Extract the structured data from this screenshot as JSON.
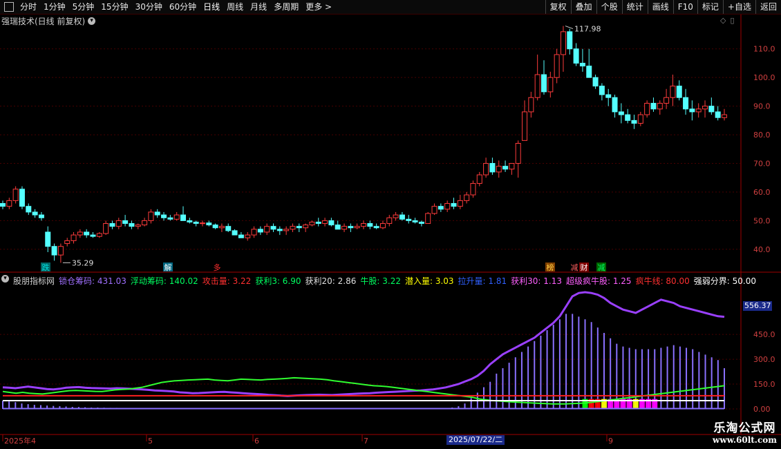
{
  "toolbar": {
    "left": [
      "分时",
      "1分钟",
      "5分钟",
      "15分钟",
      "30分钟",
      "60分钟",
      "日线",
      "周线",
      "月线",
      "多周期",
      "更多 >"
    ],
    "active": "日线",
    "right": [
      "复权",
      "叠加",
      "个股",
      "统计",
      "画线",
      "F10",
      "标记",
      "+自选",
      "返回"
    ]
  },
  "main_panel": {
    "title": "强瑞技术(日线 前复权)",
    "high_label": "117.98",
    "low_label": "35.29",
    "price_ticks": [
      "110.0",
      "100.0",
      "90.0",
      "80.0",
      "70.0",
      "60.0",
      "50.0",
      "40.0"
    ],
    "markers": [
      {
        "text": "跌",
        "color": "#00e0e0",
        "bg": "#006666"
      },
      {
        "text": "解",
        "color": "#ffffff",
        "bg": "#006680"
      },
      {
        "text": "多",
        "color": "#ff3030",
        "bg": ""
      },
      {
        "text": "榜",
        "color": "#ffcc44",
        "bg": "#804000"
      },
      {
        "text": "减",
        "color": "#ff6060",
        "bg": ""
      },
      {
        "text": "财",
        "color": "#ffffff",
        "bg": "#800000"
      },
      {
        "text": "减",
        "color": "#00ff66",
        "bg": "#006600"
      }
    ]
  },
  "indicator_panel": {
    "title": "股朋指标网",
    "items": [
      {
        "label": "锁仓筹码: 431.03",
        "color": "#a070ff"
      },
      {
        "label": "浮动筹码: 140.02",
        "color": "#00ff60"
      },
      {
        "label": "攻击量: 3.22",
        "color": "#ff3030"
      },
      {
        "label": "获利3: 6.90",
        "color": "#00ff60"
      },
      {
        "label": "获利20: 2.86",
        "color": "#e0e0e0"
      },
      {
        "label": "牛股: 3.22",
        "color": "#00ff60"
      },
      {
        "label": "潜入量: 3.03",
        "color": "#ffff00"
      },
      {
        "label": "拉升量: 1.81",
        "color": "#3060ff"
      },
      {
        "label": "获利30: 1.13",
        "color": "#ff60ff"
      },
      {
        "label": "超级疯牛股: 1.25",
        "color": "#ff60ff"
      },
      {
        "label": "疯牛线: 80.00",
        "color": "#ff3030"
      },
      {
        "label": "强弱分界: 50.00",
        "color": "#ffffff"
      }
    ],
    "ticks": [
      "450.0",
      "300.0",
      "150.0",
      "0.00"
    ],
    "current_value": "556.37"
  },
  "x_axis": {
    "labels": [
      "2025年4",
      "5",
      "6",
      "7",
      "8",
      "9"
    ],
    "cursor_date": "2025/07/22/二"
  },
  "watermark": {
    "line1": "乐淘公式网",
    "line2": "www.60lt.com"
  },
  "colors": {
    "up": "#ff3c3c",
    "down": "#54ffff",
    "grid": "#4a0000",
    "axis": "#a00000"
  },
  "chart_data": {
    "type": "candlestick",
    "ylim": [
      32,
      122
    ],
    "candles": [
      [
        56,
        57,
        54,
        55
      ],
      [
        55,
        58,
        54,
        57
      ],
      [
        57,
        62,
        56,
        61
      ],
      [
        61,
        62,
        54,
        55
      ],
      [
        55,
        56,
        52,
        53
      ],
      [
        53,
        54,
        51,
        52
      ],
      [
        52,
        53,
        50,
        51
      ],
      [
        46,
        48,
        39,
        41
      ],
      [
        41,
        42,
        36,
        38
      ],
      [
        38,
        42,
        35.29,
        41
      ],
      [
        42,
        44,
        41,
        43
      ],
      [
        43,
        46,
        42,
        45
      ],
      [
        45,
        47,
        44,
        46
      ],
      [
        46,
        47,
        44,
        45
      ],
      [
        45,
        46,
        44,
        44.5
      ],
      [
        44.5,
        46,
        44,
        45.5
      ],
      [
        45.5,
        50,
        45,
        49
      ],
      [
        49,
        50,
        47,
        48
      ],
      [
        48,
        51,
        47,
        50
      ],
      [
        50,
        52,
        48,
        49
      ],
      [
        49,
        50,
        47,
        48
      ],
      [
        48,
        49,
        47,
        48.5
      ],
      [
        48.5,
        51,
        48,
        50
      ],
      [
        50,
        54,
        49,
        53
      ],
      [
        53,
        54,
        51,
        52
      ],
      [
        52,
        53,
        50,
        51
      ],
      [
        51,
        52,
        50,
        50.5
      ],
      [
        50.5,
        53,
        50,
        52
      ],
      [
        52,
        55,
        51,
        50
      ],
      [
        50,
        51,
        49,
        49.5
      ],
      [
        49.5,
        50,
        48,
        49
      ],
      [
        49,
        50,
        48,
        49.2
      ],
      [
        49.2,
        50,
        48,
        48.5
      ],
      [
        48.5,
        49,
        47,
        47.5
      ],
      [
        47.5,
        49,
        46,
        48
      ],
      [
        48,
        49,
        46,
        46.5
      ],
      [
        46.5,
        47,
        45,
        45
      ],
      [
        45,
        46,
        44,
        44
      ],
      [
        44,
        46,
        43,
        45
      ],
      [
        45,
        48,
        44,
        47
      ],
      [
        47,
        48,
        45,
        46
      ],
      [
        46,
        49,
        45,
        48
      ],
      [
        48,
        49,
        46,
        47
      ],
      [
        47,
        48,
        45,
        46.5
      ],
      [
        46.5,
        48,
        45,
        47
      ],
      [
        47,
        49,
        46,
        48
      ],
      [
        48,
        49,
        46,
        47.5
      ],
      [
        47.5,
        49,
        46,
        48.5
      ],
      [
        48.5,
        50,
        48,
        49.5
      ],
      [
        49.5,
        51,
        48,
        49
      ],
      [
        49,
        51,
        48,
        50
      ],
      [
        50,
        51,
        48,
        48.5
      ],
      [
        48.5,
        50,
        47,
        47
      ],
      [
        47,
        49,
        46,
        48
      ],
      [
        48,
        49,
        46,
        47.5
      ],
      [
        47.5,
        49,
        47,
        48
      ],
      [
        48,
        50,
        47,
        49
      ],
      [
        49,
        50,
        47,
        48
      ],
      [
        48,
        49,
        47,
        47.5
      ],
      [
        47.5,
        50,
        47,
        49
      ],
      [
        49,
        52,
        48,
        51
      ],
      [
        51,
        53,
        50,
        52
      ],
      [
        52,
        53,
        50,
        50.5
      ],
      [
        50.5,
        52,
        49,
        50
      ],
      [
        50,
        51,
        49,
        49.5
      ],
      [
        49.5,
        50,
        48,
        49
      ],
      [
        49,
        53,
        49,
        52.5
      ],
      [
        52.5,
        56,
        52,
        55
      ],
      [
        55,
        56,
        53,
        54
      ],
      [
        54,
        57,
        53,
        56
      ],
      [
        56,
        58,
        54,
        55
      ],
      [
        55,
        59,
        54,
        57
      ],
      [
        57,
        60,
        56,
        59
      ],
      [
        59,
        64,
        58,
        63
      ],
      [
        63,
        67,
        62,
        66
      ],
      [
        66,
        72,
        65,
        70
      ],
      [
        70,
        72,
        66,
        67
      ],
      [
        67,
        71,
        65,
        69
      ],
      [
        69,
        71,
        67,
        68
      ],
      [
        68,
        70,
        66,
        70
      ],
      [
        70,
        78,
        65,
        77
      ],
      [
        78,
        92,
        79,
        88
      ],
      [
        88,
        95,
        86,
        93
      ],
      [
        93,
        108,
        92,
        101
      ],
      [
        101,
        106,
        94,
        95
      ],
      [
        95,
        102,
        93,
        100
      ],
      [
        100,
        110,
        98,
        108
      ],
      [
        108,
        118,
        102,
        116
      ],
      [
        116,
        117,
        108,
        110
      ],
      [
        110,
        112,
        104,
        105
      ],
      [
        105,
        110,
        102,
        104
      ],
      [
        104,
        110,
        100,
        100
      ],
      [
        100,
        101,
        96,
        97
      ],
      [
        97,
        98,
        92,
        94
      ],
      [
        94,
        96,
        90,
        93
      ],
      [
        93,
        94,
        86,
        88
      ],
      [
        88,
        91,
        84,
        87
      ],
      [
        87,
        89,
        84,
        85
      ],
      [
        85,
        87,
        82,
        84
      ],
      [
        84,
        88,
        83,
        87
      ],
      [
        87,
        92,
        86,
        91
      ],
      [
        91,
        93,
        88,
        89
      ],
      [
        89,
        92,
        87,
        91
      ],
      [
        91,
        96,
        89,
        93
      ],
      [
        93,
        101,
        90,
        97
      ],
      [
        97,
        99,
        92,
        93
      ],
      [
        93,
        96,
        87,
        89
      ],
      [
        89,
        92,
        85,
        88
      ],
      [
        88,
        91,
        86,
        89
      ],
      [
        89,
        92,
        86,
        90
      ],
      [
        90,
        93,
        87,
        88
      ],
      [
        88,
        90,
        85,
        86
      ],
      [
        86,
        89,
        85,
        87
      ]
    ],
    "indicator": {
      "ylim": [
        0,
        680
      ],
      "lock_chip_line": [
        130,
        128,
        125,
        130,
        135,
        130,
        125,
        120,
        118,
        122,
        128,
        130,
        132,
        128,
        126,
        125,
        124,
        123,
        125,
        124,
        122,
        120,
        118,
        115,
        112,
        110,
        108,
        105,
        100,
        98,
        95,
        96,
        98,
        100,
        102,
        103,
        100,
        98,
        95,
        92,
        90,
        88,
        85,
        83,
        80,
        78,
        80,
        82,
        84,
        85,
        86,
        85,
        84,
        86,
        88,
        90,
        92,
        94,
        95,
        98,
        100,
        102,
        104,
        106,
        108,
        110,
        112,
        115,
        118,
        124,
        130,
        140,
        150,
        165,
        180,
        200,
        230,
        270,
        300,
        330,
        350,
        370,
        390,
        410,
        430,
        460,
        490,
        520,
        560,
        620,
        680,
        700,
        705,
        700,
        690,
        670,
        640,
        620,
        600,
        590,
        580,
        600,
        620,
        640,
        660,
        650,
        640,
        620,
        610,
        600,
        590,
        580,
        570,
        560,
        556.37
      ],
      "float_chip_line": [
        105,
        100,
        95,
        100,
        95,
        92,
        90,
        95,
        100,
        105,
        110,
        112,
        110,
        108,
        106,
        105,
        110,
        115,
        118,
        120,
        125,
        130,
        140,
        150,
        160,
        165,
        170,
        172,
        175,
        176,
        178,
        180,
        175,
        172,
        170,
        175,
        180,
        178,
        176,
        175,
        178,
        180,
        182,
        185,
        188,
        186,
        184,
        182,
        180,
        176,
        170,
        165,
        160,
        155,
        150,
        145,
        140,
        138,
        135,
        130,
        125,
        120,
        115,
        110,
        105,
        100,
        95,
        90,
        85,
        80,
        75,
        70,
        60,
        55,
        50,
        48,
        45,
        42,
        40,
        38,
        36,
        34,
        32,
        30,
        30,
        30,
        32,
        34,
        36,
        40,
        45,
        50,
        55,
        60,
        65,
        70,
        75,
        80,
        85,
        90,
        95,
        100,
        105,
        110,
        115,
        120,
        125,
        130,
        135,
        140
      ],
      "threshold_a": 80,
      "threshold_b": 50,
      "bars": [
        60,
        55,
        50,
        40,
        35,
        30,
        28,
        25,
        22,
        20,
        18,
        15,
        14,
        12,
        10,
        10,
        9,
        8,
        8,
        7,
        6,
        6,
        5,
        5,
        5,
        4,
        4,
        4,
        4,
        4,
        4,
        4,
        4,
        4,
        4,
        4,
        4,
        4,
        4,
        4,
        4,
        4,
        4,
        4,
        4,
        4,
        4,
        4,
        4,
        4,
        4,
        4,
        4,
        4,
        4,
        4,
        4,
        4,
        4,
        4,
        4,
        4,
        4,
        4,
        4,
        4,
        4,
        4,
        4,
        4,
        4,
        10,
        20,
        40,
        80,
        120,
        160,
        200,
        260,
        300,
        340,
        380,
        420,
        460,
        500,
        540,
        580,
        620,
        660,
        700,
        700,
        680,
        660,
        640,
        600,
        560,
        520,
        480,
        460,
        450,
        440,
        440,
        440,
        440,
        450,
        460,
        470,
        460,
        450,
        440,
        420,
        400,
        380,
        360,
        300
      ]
    }
  }
}
